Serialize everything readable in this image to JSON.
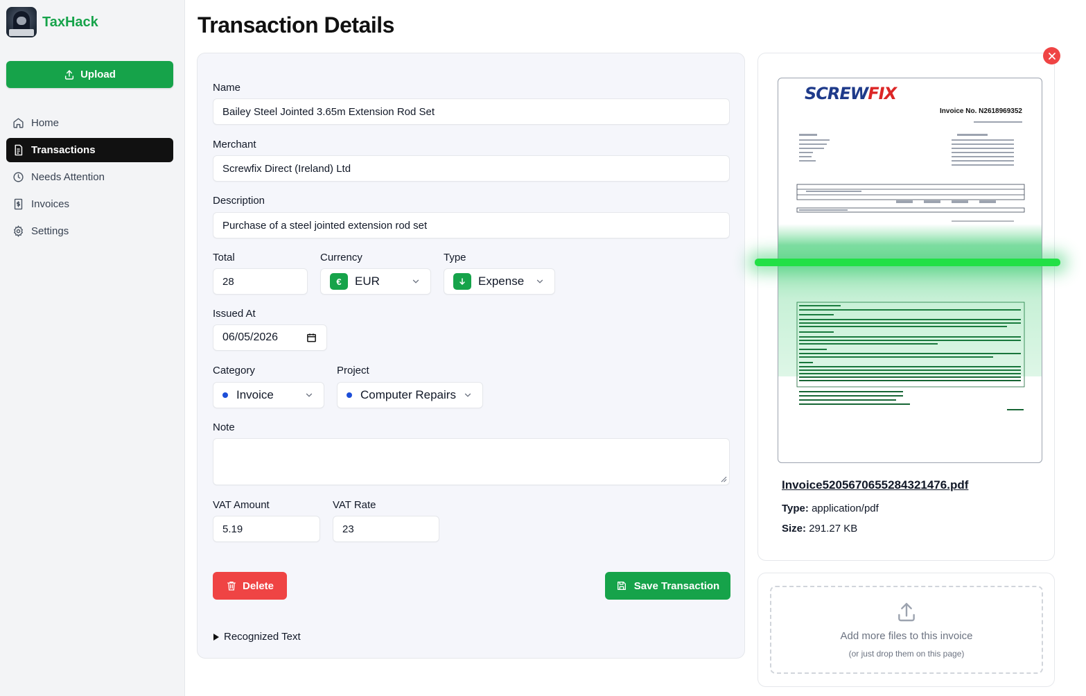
{
  "app": {
    "name": "TaxHack"
  },
  "sidebar": {
    "upload_label": "Upload",
    "items": [
      {
        "label": "Home",
        "icon": "home-icon",
        "active": false
      },
      {
        "label": "Transactions",
        "icon": "receipt-icon",
        "active": true
      },
      {
        "label": "Needs Attention",
        "icon": "clock-alert-icon",
        "active": false
      },
      {
        "label": "Invoices",
        "icon": "invoice-icon",
        "active": false
      },
      {
        "label": "Settings",
        "icon": "gear-icon",
        "active": false
      }
    ]
  },
  "page": {
    "title": "Transaction Details"
  },
  "form": {
    "name": {
      "label": "Name",
      "value": "Bailey Steel Jointed 3.65m Extension Rod Set"
    },
    "merchant": {
      "label": "Merchant",
      "value": "Screwfix Direct (Ireland) Ltd"
    },
    "description": {
      "label": "Description",
      "value": "Purchase of a steel jointed extension rod set"
    },
    "total": {
      "label": "Total",
      "value": "28"
    },
    "currency": {
      "label": "Currency",
      "value": "EUR",
      "symbol": "€"
    },
    "type": {
      "label": "Type",
      "value": "Expense"
    },
    "issued_at": {
      "label": "Issued At",
      "value": "06/05/2026"
    },
    "category": {
      "label": "Category",
      "value": "Invoice"
    },
    "project": {
      "label": "Project",
      "value": "Computer Repairs"
    },
    "note": {
      "label": "Note",
      "value": ""
    },
    "vat_amount": {
      "label": "VAT Amount",
      "value": "5.19"
    },
    "vat_rate": {
      "label": "VAT Rate",
      "value": "23"
    },
    "delete_label": "Delete",
    "save_label": "Save Transaction",
    "recognized_text_label": "Recognized Text"
  },
  "preview": {
    "doc_logo_a": "SCREW",
    "doc_logo_b": "FIX",
    "doc_invoice_no": "Invoice No. N2618969352",
    "file_name": "Invoice5205670655284321476.pdf",
    "type_label": "Type:",
    "type_value": "application/pdf",
    "size_label": "Size:",
    "size_value": "291.27 KB"
  },
  "dropzone": {
    "title": "Add more files to this invoice",
    "subtitle": "(or just drop them on this page)"
  },
  "colors": {
    "accent": "#16a34a",
    "danger": "#ef4444",
    "active_nav": "#111111",
    "scan": "#22e046"
  }
}
